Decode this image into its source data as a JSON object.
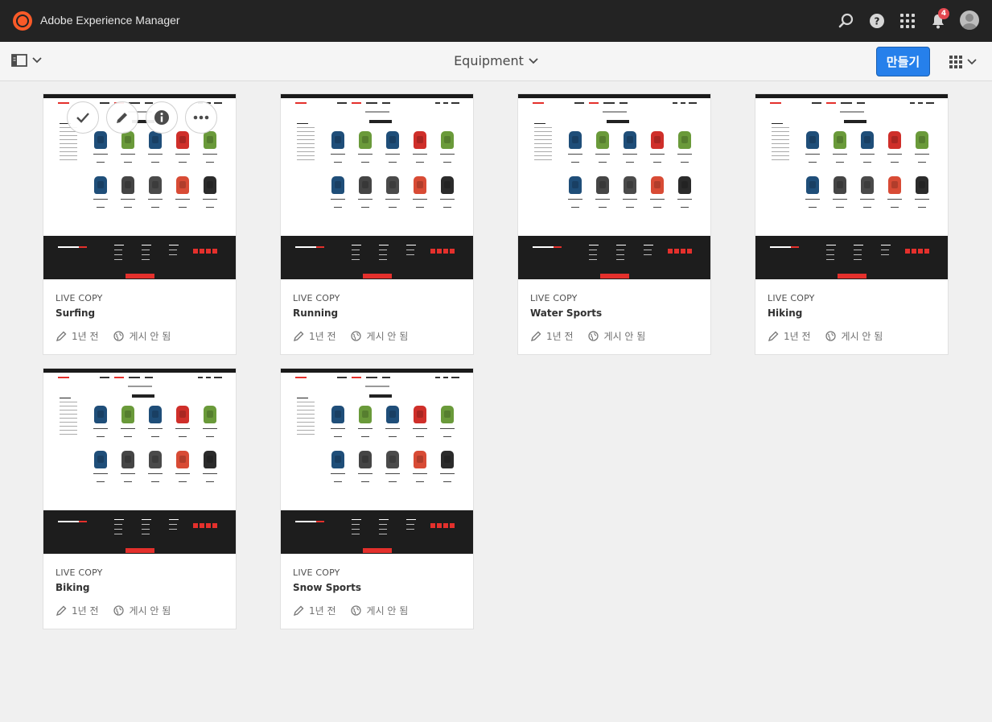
{
  "shell": {
    "app_name": "Adobe Experience Manager",
    "notification_count": "4",
    "icons": [
      "adobe-logo-icon",
      "search-icon",
      "help-icon",
      "solutions-grid-icon",
      "bell-icon",
      "user-avatar"
    ]
  },
  "actionbar": {
    "title": "Equipment",
    "create_label": "만들기",
    "rail_icon": "side-panel-icon",
    "view_icon": "card-view-icon"
  },
  "colors": {
    "accent": "#2680eb",
    "shell_bg": "#232323",
    "badge": "#e34850",
    "site_red": "#e4302c"
  },
  "cards": [
    {
      "kind": "LIVE COPY",
      "name": "Surfing",
      "modified": "1년 전",
      "publish": "게시 안 됨"
    },
    {
      "kind": "LIVE COPY",
      "name": "Running",
      "modified": "1년 전",
      "publish": "게시 안 됨"
    },
    {
      "kind": "LIVE COPY",
      "name": "Water Sports",
      "modified": "1년 전",
      "publish": "게시 안 됨"
    },
    {
      "kind": "LIVE COPY",
      "name": "Hiking",
      "modified": "1년 전",
      "publish": "게시 안 됨"
    },
    {
      "kind": "LIVE COPY",
      "name": "Biking",
      "modified": "1년 전",
      "publish": "게시 안 됨"
    },
    {
      "kind": "LIVE COPY",
      "name": "Snow Sports",
      "modified": "1년 전",
      "publish": "게시 안 됨"
    }
  ],
  "quick_actions": [
    "select-check-icon",
    "edit-pencil-icon",
    "properties-info-icon",
    "more-ellipsis-icon"
  ]
}
